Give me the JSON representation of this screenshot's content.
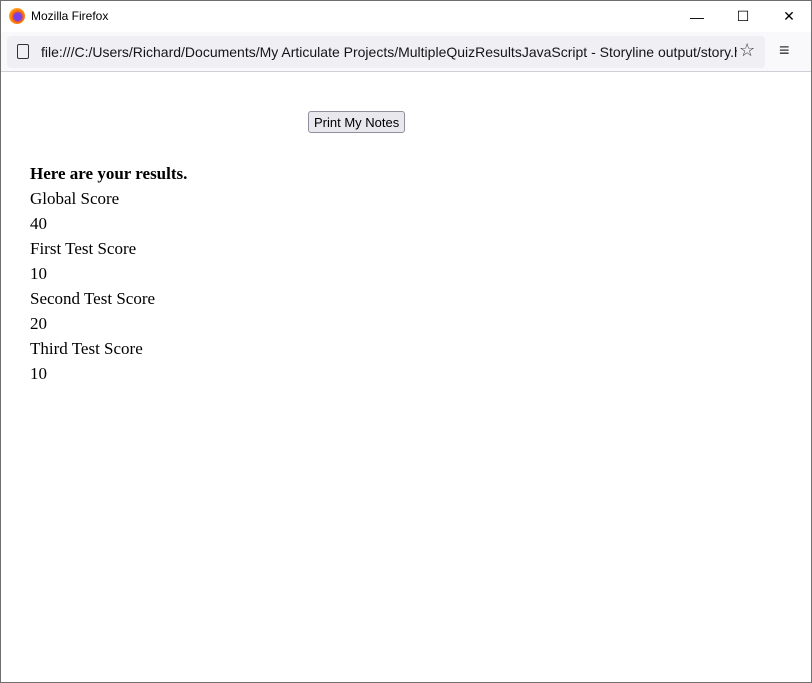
{
  "window": {
    "title": "Mozilla Firefox",
    "minimize": "—",
    "maximize": "☐",
    "close": "✕"
  },
  "navbar": {
    "url": "file:///C:/Users/Richard/Documents/My Articulate Projects/MultipleQuizResultsJavaScript - Storyline output/story.html",
    "star": "☆",
    "menu": "≡"
  },
  "page": {
    "print_button": "Print My Notes",
    "heading": "Here are your results.",
    "scores": [
      {
        "label": "Global Score",
        "value": "40"
      },
      {
        "label": "First Test Score",
        "value": "10"
      },
      {
        "label": "Second Test Score",
        "value": "20"
      },
      {
        "label": "Third Test Score",
        "value": "10"
      }
    ]
  }
}
